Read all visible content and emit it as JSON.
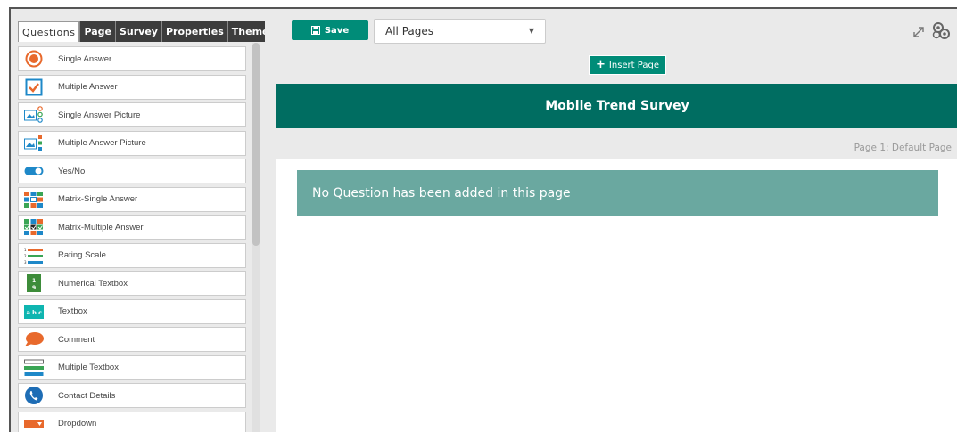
{
  "tabs": [
    {
      "label": "Questions",
      "active": true
    },
    {
      "label": "Page"
    },
    {
      "label": "Survey"
    },
    {
      "label": "Properties"
    },
    {
      "label": "Theme"
    }
  ],
  "question_types": [
    {
      "label": "Single Answer",
      "icon": "radio-icon"
    },
    {
      "label": "Multiple Answer",
      "icon": "checkbox-icon"
    },
    {
      "label": "Single Answer Picture",
      "icon": "picture-radio-icon"
    },
    {
      "label": "Multiple Answer Picture",
      "icon": "picture-checkbox-icon"
    },
    {
      "label": "Yes/No",
      "icon": "toggle-icon"
    },
    {
      "label": "Matrix-Single Answer",
      "icon": "matrix-icon"
    },
    {
      "label": "Matrix-Multiple Answer",
      "icon": "matrix-check-icon"
    },
    {
      "label": "Rating Scale",
      "icon": "rating-scale-icon"
    },
    {
      "label": "Numerical Textbox",
      "icon": "numerical-icon"
    },
    {
      "label": "Textbox",
      "icon": "textbox-icon"
    },
    {
      "label": "Comment",
      "icon": "comment-icon"
    },
    {
      "label": "Multiple Textbox",
      "icon": "multiple-textbox-icon"
    },
    {
      "label": "Contact Details",
      "icon": "phone-icon"
    },
    {
      "label": "Dropdown",
      "icon": "dropdown-icon"
    }
  ],
  "toolbar": {
    "save_label": "Save",
    "page_select": "All Pages"
  },
  "main": {
    "insert_page_label": "Insert Page",
    "survey_title": "Mobile Trend Survey",
    "page_label": "Page 1:  Default Page",
    "empty_message": "No Question has been added in this page"
  },
  "colors": {
    "accent": "#008c78",
    "title_bar": "#006d61",
    "empty_msg": "#6aa8a0"
  }
}
